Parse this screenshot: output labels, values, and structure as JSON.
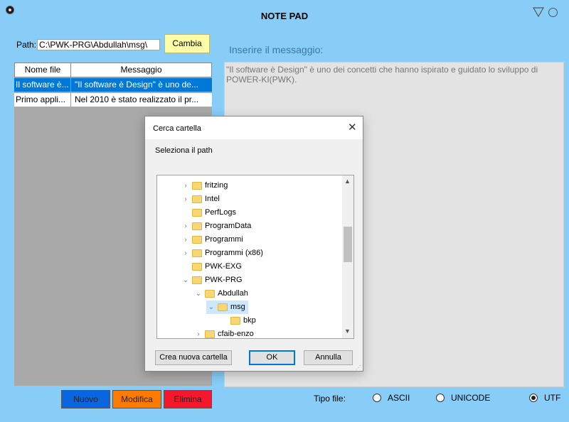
{
  "app": {
    "title": "NOTE PAD"
  },
  "path": {
    "label": "Path:",
    "value": "C:\\PWK-PRG\\Abdullah\\msg\\",
    "change_button": "Cambia"
  },
  "table": {
    "headers": [
      "Nome file",
      "Messaggio"
    ],
    "rows": [
      {
        "name": "Il software è...",
        "message": "\"Il software è Design\" è uno de...",
        "selected": true
      },
      {
        "name": "Primo appli...",
        "message": "Nel 2010 è stato realizzato il pr...",
        "selected": false
      }
    ]
  },
  "message": {
    "label": "Inserire il messaggio:",
    "text": "\"Il software è Design\" è uno dei concetti che hanno ispirato e guidato lo sviluppo di POWER-KI(PWK)."
  },
  "actions": {
    "new": "Nuovo",
    "edit": "Modifica",
    "delete": "Elimina"
  },
  "file_type": {
    "label": "Tipo file:",
    "options": [
      "ASCII",
      "UNICODE",
      "UTF"
    ],
    "selected": "UTF"
  },
  "dialog": {
    "title": "Cerca cartella",
    "subtitle": "Seleziona il path",
    "tree": [
      {
        "label": "fritzing",
        "chev": ">",
        "indent": 0
      },
      {
        "label": "Intel",
        "chev": ">",
        "indent": 0
      },
      {
        "label": "PerfLogs",
        "chev": "",
        "indent": 0
      },
      {
        "label": "ProgramData",
        "chev": ">",
        "indent": 0
      },
      {
        "label": "Programmi",
        "chev": ">",
        "indent": 0
      },
      {
        "label": "Programmi (x86)",
        "chev": ">",
        "indent": 0
      },
      {
        "label": "PWK-EXG",
        "chev": "",
        "indent": 0
      },
      {
        "label": "PWK-PRG",
        "chev": "v",
        "indent": 0
      },
      {
        "label": "Abdullah",
        "chev": "v",
        "indent": 1
      },
      {
        "label": "msg",
        "chev": "v",
        "indent": 2,
        "selected": true
      },
      {
        "label": "bkp",
        "chev": "",
        "indent": 3
      },
      {
        "label": "cfaib-enzo",
        "chev": ">",
        "indent": 1
      }
    ],
    "buttons": {
      "new_folder": "Crea nuova cartella",
      "ok": "OK",
      "cancel": "Annulla"
    }
  },
  "colors": {
    "background": "#87cdf7",
    "selected_row": "#0078d7",
    "nuovo": "#0a66e0",
    "modifica": "#ff7b00",
    "elimina": "#f5182d",
    "cambia": "#ffffa8"
  }
}
